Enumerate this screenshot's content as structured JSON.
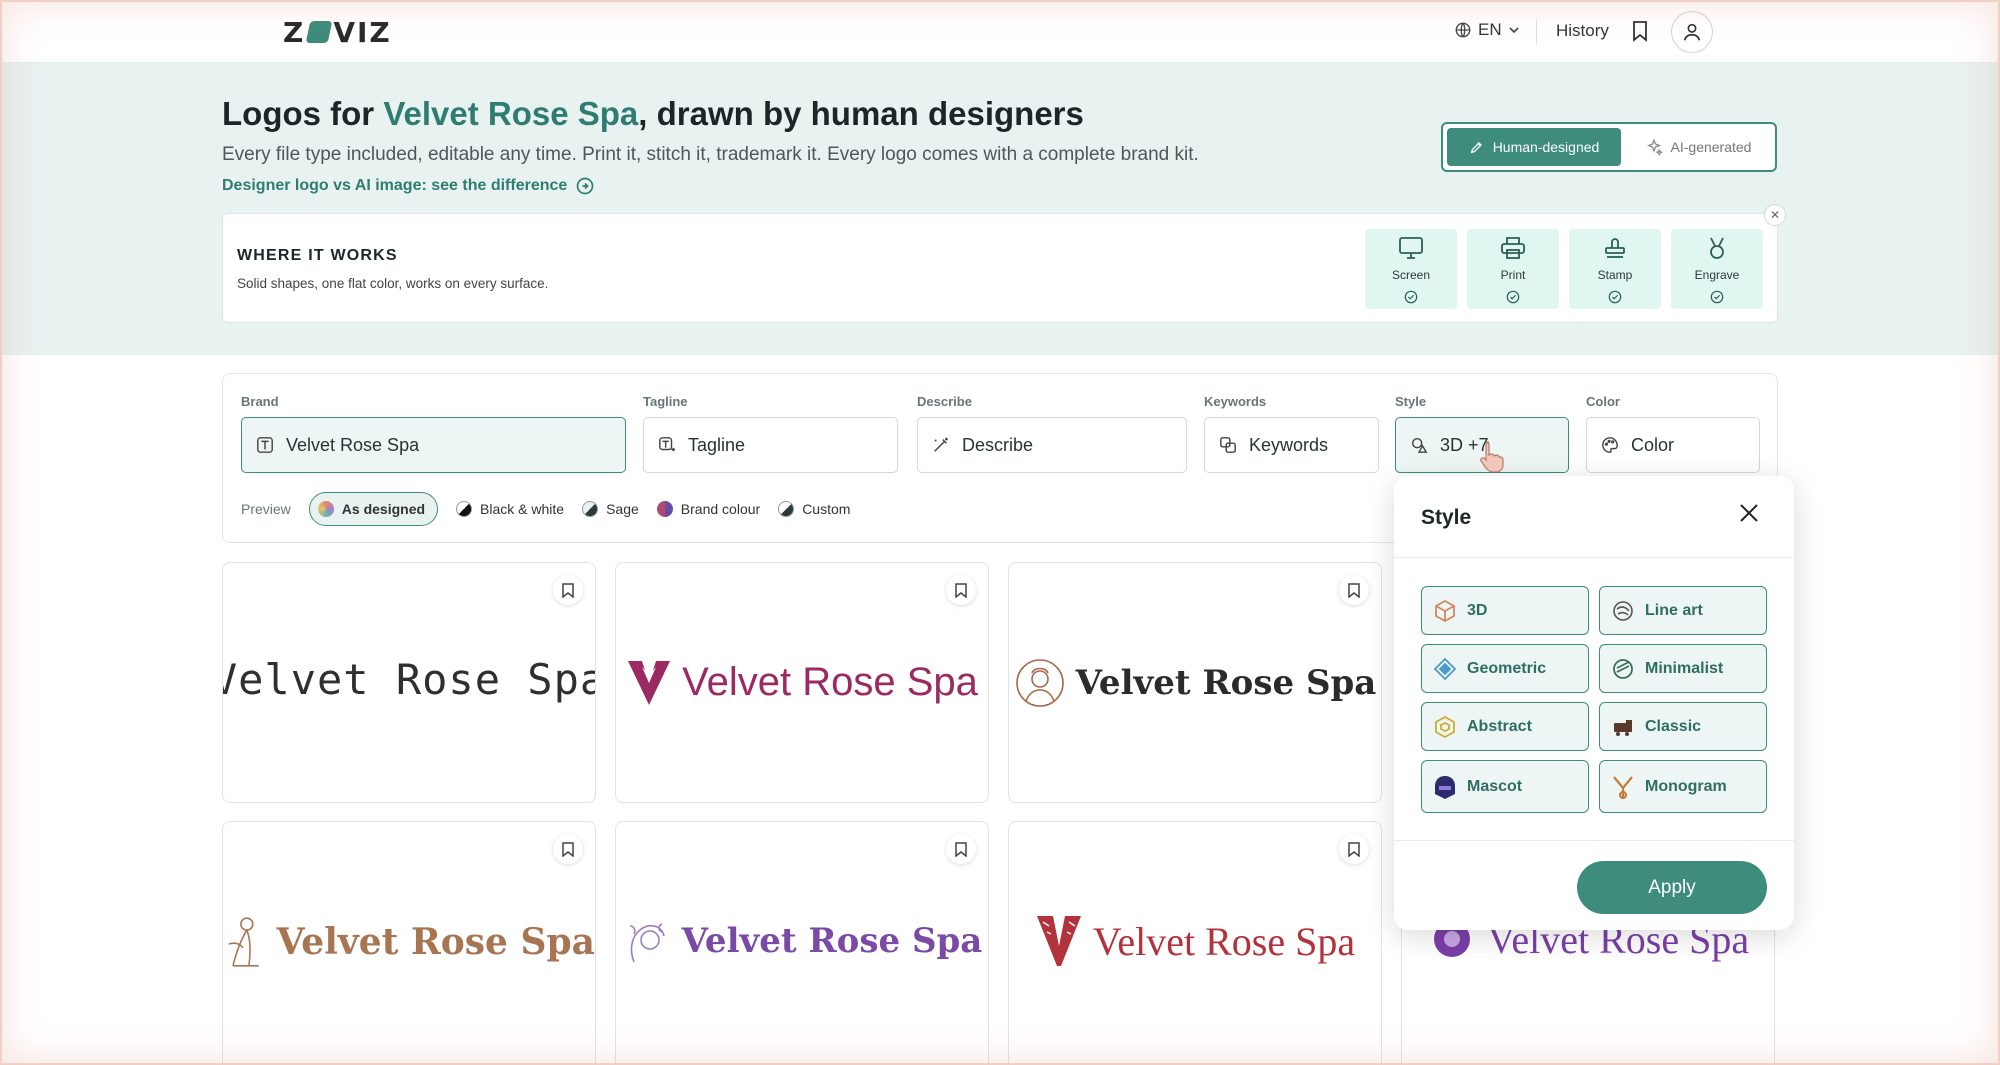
{
  "header": {
    "logo_text": "ZVIZ",
    "language": "EN",
    "history_label": "History"
  },
  "hero": {
    "title_prefix": "Logos for ",
    "title_brand": "Velvet Rose Spa",
    "title_suffix": ", drawn by human designers",
    "subtitle": "Every file type included, editable any time. Print it, stitch it, trademark it. Every logo comes with a complete brand kit.",
    "diff_link": "Designer logo vs AI image: see the difference",
    "toggle": {
      "human": "Human-designed",
      "ai": "AI-generated",
      "selected": "Human-designed"
    }
  },
  "where_it_works": {
    "title": "WHERE IT WORKS",
    "description": "Solid shapes, one flat color, works on every surface.",
    "surfaces": [
      "Screen",
      "Print",
      "Stamp",
      "Engrave"
    ]
  },
  "search": {
    "brand": {
      "label": "Brand",
      "value": "Velvet Rose Spa"
    },
    "tagline": {
      "label": "Tagline",
      "placeholder": "Tagline"
    },
    "describe": {
      "label": "Describe",
      "placeholder": "Describe"
    },
    "keywords": {
      "label": "Keywords",
      "placeholder": "Keywords"
    },
    "style": {
      "label": "Style",
      "value": "3D +7"
    },
    "color": {
      "label": "Color",
      "placeholder": "Color"
    }
  },
  "preview": {
    "label": "Preview",
    "options": [
      "As designed",
      "Black & white",
      "Sage",
      "Brand colour",
      "Custom"
    ],
    "selected": "As designed"
  },
  "logos": [
    {
      "text": "Velvet Rose Spa",
      "color": "#2f2f2f"
    },
    {
      "text": "Velvet Rose Spa",
      "color": "#9b2a63"
    },
    {
      "text": "Velvet Rose Spa",
      "color": "#2b2b2b"
    },
    {
      "text": "Velvet Rose Spa",
      "color": "#a77552"
    },
    {
      "text": "Velvet Rose Spa",
      "color": "#7a4aa6"
    },
    {
      "text": "Velvet Rose Spa",
      "color": "#b2333c"
    },
    {
      "text": "Velvet Rose Spa",
      "color": "#7b3fa8"
    }
  ],
  "style_popover": {
    "title": "Style",
    "options": [
      "3D",
      "Line art",
      "Geometric",
      "Minimalist",
      "Abstract",
      "Classic",
      "Mascot",
      "Monogram"
    ],
    "apply_label": "Apply"
  },
  "colors": {
    "accent": "#3d8c7c",
    "hero_bg": "#e8f2f1"
  }
}
